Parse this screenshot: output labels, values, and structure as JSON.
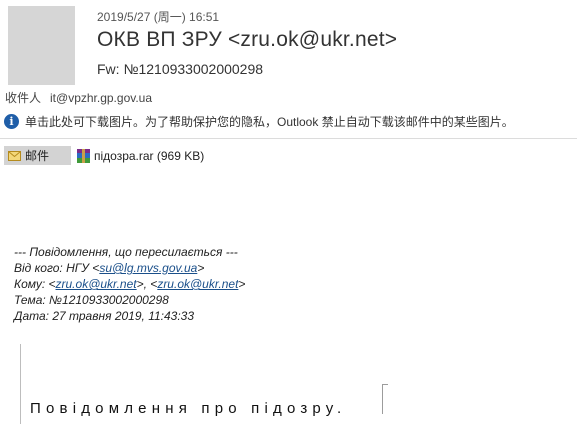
{
  "email": {
    "date": "2019/5/27 (周一) 16:51",
    "sender": "ОКВ ВП ЗРУ <zru.ok@ukr.net>",
    "subject": "Fw: №1210933002000298",
    "to_label": "收件人",
    "to_value": "it@vpzhr.gp.gov.ua",
    "info_message": "单击此处可下载图片。为了帮助保护您的隐私，Outlook 禁止自动下载该邮件中的某些图片。"
  },
  "attachments": {
    "mail_label": "邮件",
    "file_name": "підозра.rar (969 KB)"
  },
  "forwarded": {
    "header": "--- Повідомлення, що пересилається ---",
    "from_label": "Від кого: НГУ <",
    "from_link": "su@lg.mvs.gov.ua",
    "from_end": ">",
    "to_label": "Кому: <",
    "to_link_1": "zru.ok@ukr.net",
    "to_sep": ">, <",
    "to_link_2": "zru.ok@ukr.net",
    "to_end": ">",
    "subject_line": "Тема: №1210933002000298",
    "date_line": "Дата: 27 травня 2019, 11:43:33"
  },
  "body": {
    "headline": "Повідомлення про підозру."
  },
  "icons": {
    "avatar": "person-silhouette-icon",
    "info": "info-icon",
    "mail": "envelope-icon",
    "attachment": "rar-archive-icon"
  }
}
